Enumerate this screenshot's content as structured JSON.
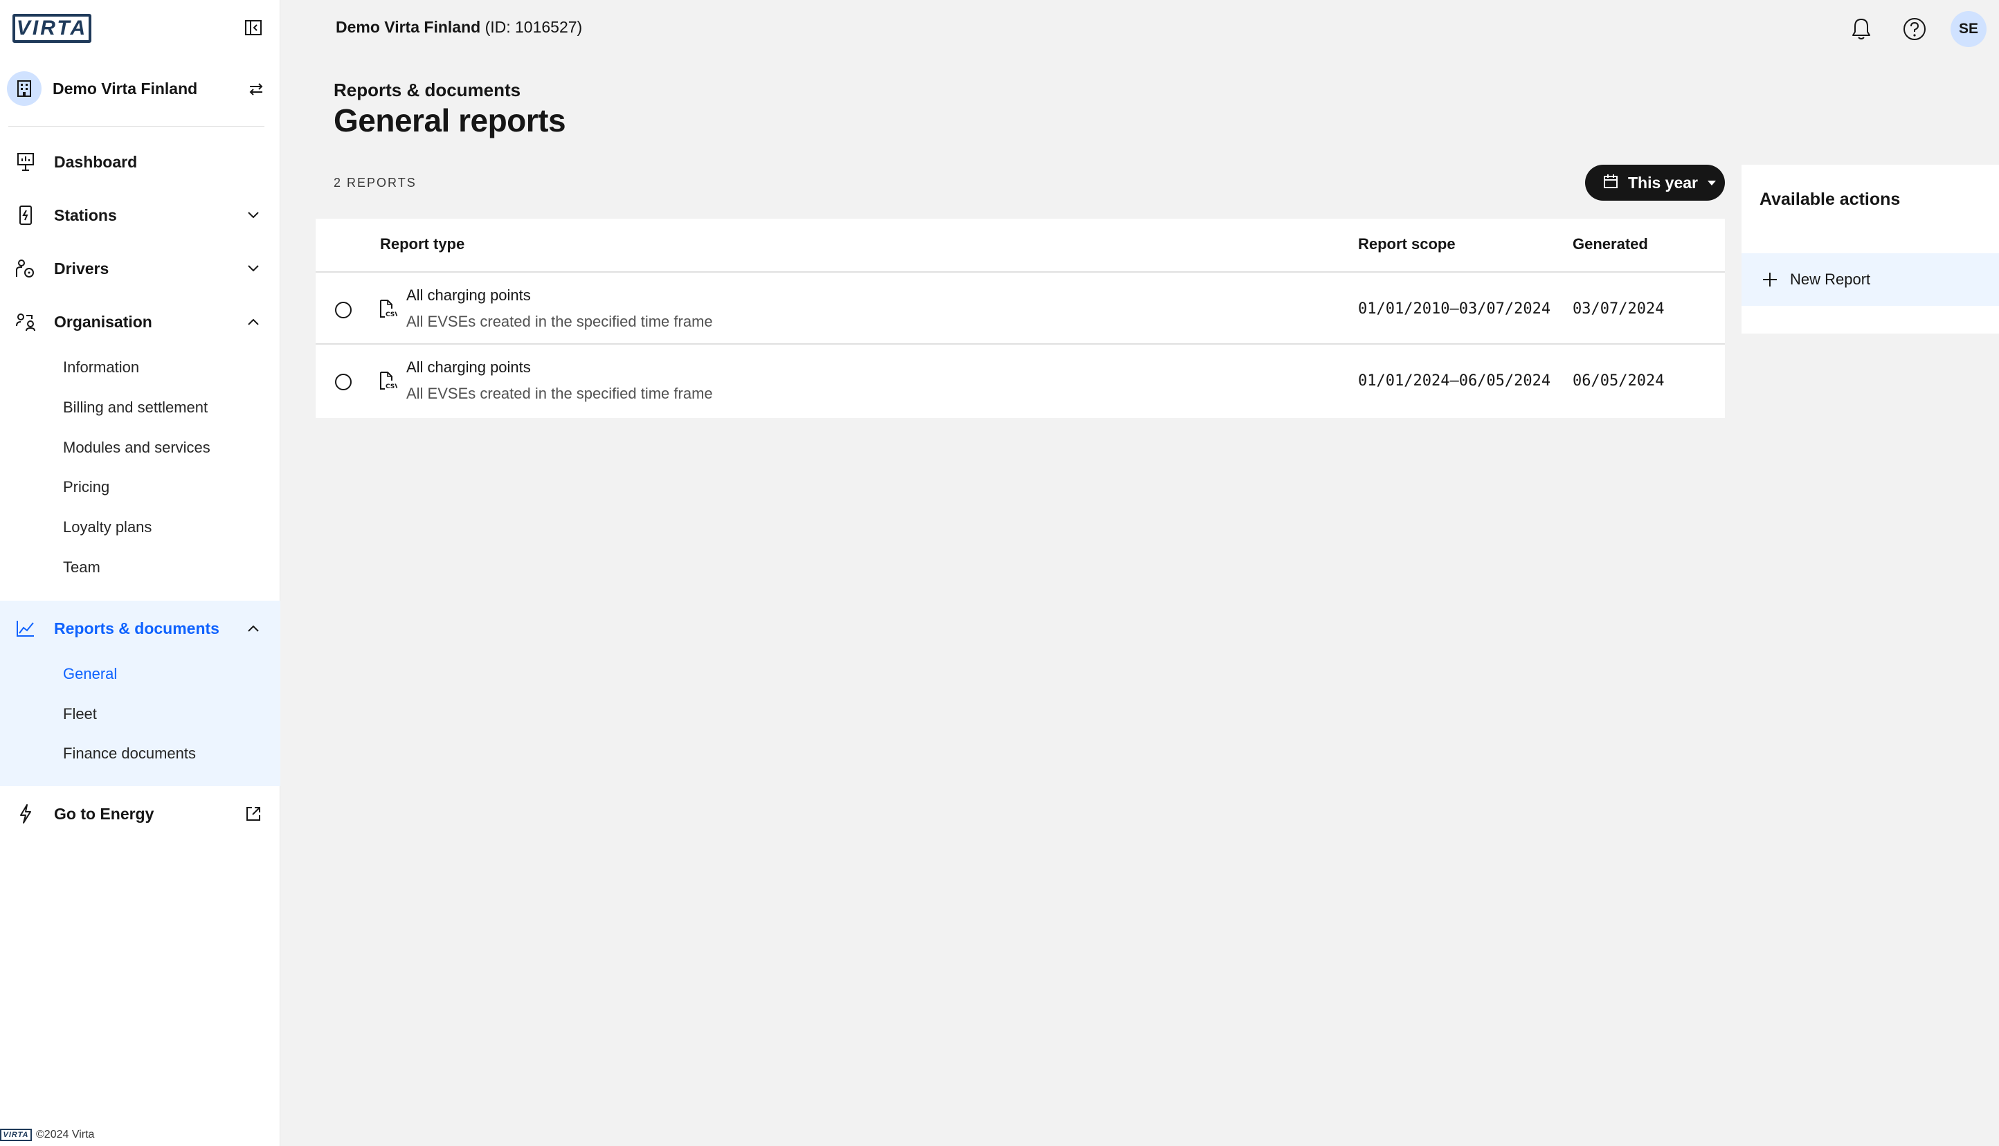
{
  "brand": {
    "logo_text": "VIRTA",
    "footer_text": "©2024 Virta"
  },
  "sidebar": {
    "org_name": "Demo Virta Finland",
    "nav": {
      "dashboard": "Dashboard",
      "stations": "Stations",
      "drivers": "Drivers",
      "organisation": "Organisation",
      "reports": "Reports & documents",
      "energy": "Go to Energy"
    },
    "organisation_items": [
      "Information",
      "Billing and settlement",
      "Modules and services",
      "Pricing",
      "Loyalty plans",
      "Team"
    ],
    "reports_items": [
      "General",
      "Fleet",
      "Finance documents"
    ],
    "active_item": "General"
  },
  "topbar": {
    "org_name": "Demo Virta Finland",
    "org_id": "(ID: 1016527)",
    "user_initials": "SE"
  },
  "page": {
    "breadcrumb": "Reports & documents",
    "title": "General reports",
    "report_count": "2 REPORTS",
    "filter_label": "This year"
  },
  "table": {
    "headers": {
      "type": "Report type",
      "scope": "Report scope",
      "generated": "Generated"
    },
    "rows": [
      {
        "title": "All charging points",
        "description": "All EVSEs created in the specified time frame",
        "scope": "01/01/2010–03/07/2024",
        "generated": "03/07/2024"
      },
      {
        "title": "All charging points",
        "description": "All EVSEs created in the specified time frame",
        "scope": "01/01/2024–06/05/2024",
        "generated": "06/05/2024"
      }
    ]
  },
  "actions": {
    "title": "Available actions",
    "new_report": "New Report"
  },
  "colors": {
    "accent": "#0f62fe",
    "active_bg": "#edf5ff",
    "avatar_bg": "#d0e2ff",
    "logo": "#1f3a5a"
  }
}
